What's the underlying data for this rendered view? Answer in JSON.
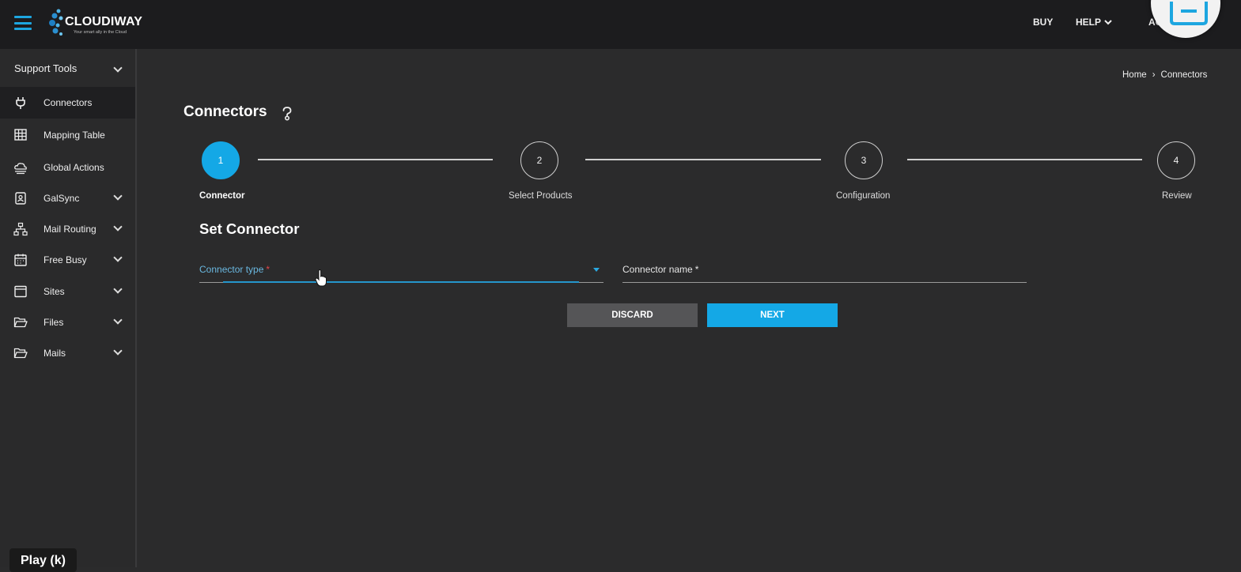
{
  "header": {
    "logo_text": "CLOUDIWAY",
    "logo_tagline": "Your smart ally in the Cloud",
    "nav": {
      "buy": "BUY",
      "help": "HELP",
      "account": "AC"
    }
  },
  "sidebar": {
    "section_title": "Support Tools",
    "items": [
      {
        "label": "Connectors",
        "icon": "plug-icon",
        "active": true,
        "expandable": false
      },
      {
        "label": "Mapping Table",
        "icon": "grid-icon",
        "active": false,
        "expandable": false
      },
      {
        "label": "Global Actions",
        "icon": "cloud-icon",
        "active": false,
        "expandable": false
      },
      {
        "label": "GalSync",
        "icon": "contact-book-icon",
        "active": false,
        "expandable": true
      },
      {
        "label": "Mail Routing",
        "icon": "network-icon",
        "active": false,
        "expandable": true
      },
      {
        "label": "Free Busy",
        "icon": "calendar-icon",
        "active": false,
        "expandable": true
      },
      {
        "label": "Sites",
        "icon": "window-icon",
        "active": false,
        "expandable": true
      },
      {
        "label": "Files",
        "icon": "folder-open-icon",
        "active": false,
        "expandable": true
      },
      {
        "label": "Mails",
        "icon": "folder-open-icon",
        "active": false,
        "expandable": true
      }
    ]
  },
  "breadcrumb": {
    "home": "Home",
    "separator": "›",
    "current": "Connectors"
  },
  "page": {
    "title": "Connectors"
  },
  "stepper": {
    "steps": [
      {
        "number": "1",
        "label": "Connector",
        "active": true
      },
      {
        "number": "2",
        "label": "Select Products",
        "active": false
      },
      {
        "number": "3",
        "label": "Configuration",
        "active": false
      },
      {
        "number": "4",
        "label": "Review",
        "active": false
      }
    ]
  },
  "form": {
    "section_title": "Set Connector",
    "connector_type": {
      "label": "Connector type",
      "required_mark": "*"
    },
    "connector_name": {
      "label": "Connector name",
      "required_mark": "*"
    },
    "discard_label": "DISCARD",
    "next_label": "NEXT"
  },
  "player": {
    "tooltip": "Play (k)"
  },
  "colors": {
    "accent": "#14a8e6",
    "topbar": "#1c1c1e",
    "background": "#2b2b2c",
    "required": "#e0444a"
  }
}
